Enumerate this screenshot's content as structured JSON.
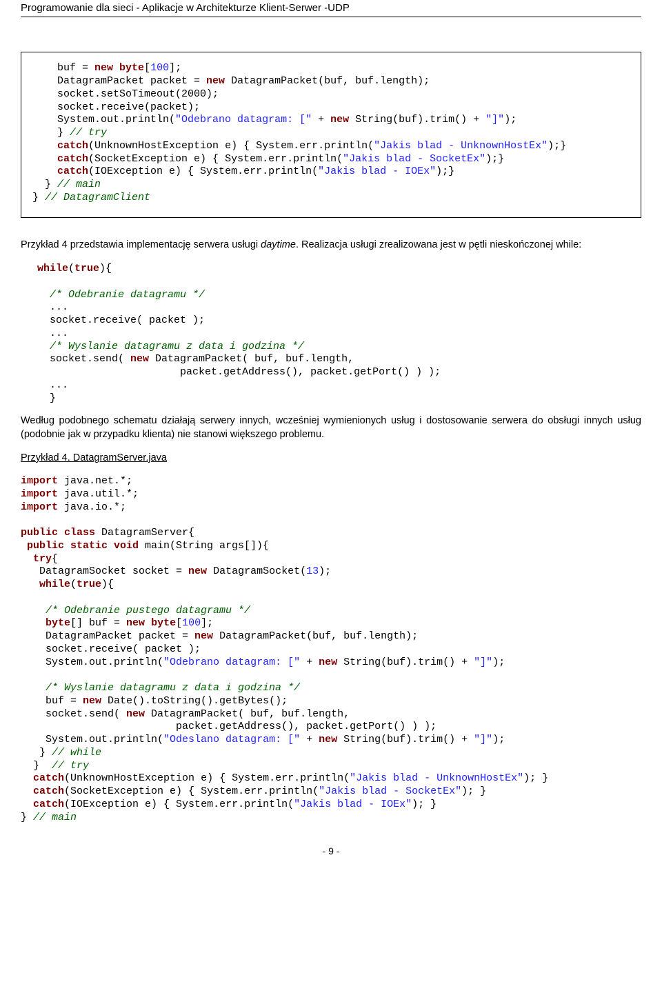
{
  "header": {
    "title": "Programowanie dla sieci - Aplikacje w Architekturze Klient-Serwer -UDP"
  },
  "code1": {
    "l1a": "    buf = ",
    "l1b": "new",
    "l1c": " ",
    "l1d": "byte",
    "l1e": "[",
    "l1f": "100",
    "l1g": "];",
    "l2a": "    DatagramPacket packet = ",
    "l2b": "new",
    "l2c": " DatagramPacket(buf, buf.length);",
    "l3": "    socket.setSoTimeout(2000);",
    "l4": "    socket.receive(packet);",
    "l5a": "    System.out.println(",
    "l5b": "\"Odebrano datagram: [\"",
    "l5c": " + ",
    "l5d": "new",
    "l5e": " String(buf).trim() + ",
    "l5f": "\"]\"",
    "l5g": ");",
    "l6a": "    } ",
    "l6b": "// try",
    "l7a": "    ",
    "l7b": "catch",
    "l7c": "(UnknownHostException e) { System.err.println(",
    "l7d": "\"Jakis blad - UnknownHostEx\"",
    "l7e": ");}",
    "l8a": "    ",
    "l8b": "catch",
    "l8c": "(SocketException e) { System.err.println(",
    "l8d": "\"Jakis blad - SocketEx\"",
    "l8e": ");}",
    "l9a": "    ",
    "l9b": "catch",
    "l9c": "(IOException e) { System.err.println(",
    "l9d": "\"Jakis blad - IOEx\"",
    "l9e": ");}",
    "l10a": "  } ",
    "l10b": "// main",
    "l11a": "} ",
    "l11b": "// DatagramClient"
  },
  "para1": {
    "t1": "Przykład 4 przedstawia implementację serwera usługi ",
    "it1": "daytime",
    "t2": ". Realizacja usługi zrealizowana jest w pętli nieskończonej while:"
  },
  "code2": {
    "l1a": "while",
    "l1b": "(",
    "l1c": "true",
    "l1d": "){",
    "blank1": "",
    "l2": "  /* Odebranie datagramu */",
    "l3": "  ...",
    "l4": "  socket.receive( packet );",
    "l5": "  ...",
    "l6": "  /* Wyslanie datagramu z data i godzina */",
    "l7a": "  socket.send( ",
    "l7b": "new",
    "l7c": " DatagramPacket( buf, buf.length,",
    "l8": "                       packet.getAddress(), packet.getPort() ) );",
    "l9": "  ...",
    "l10": "  }"
  },
  "para2": "Według podobnego schematu działają serwery innych, wcześniej wymienionych usług i dostosowanie serwera do obsługi innych usług (podobnie jak w przypadku klienta) nie stanowi większego problemu.",
  "heading4": "Przykład 4. DatagramServer.java",
  "code3": {
    "l1a": "import",
    "l1b": " java.net.*;",
    "l2a": "import",
    "l2b": " java.util.*;",
    "l3a": "import",
    "l3b": " java.io.*;",
    "blank1": "",
    "l4a": "public class",
    "l4b": " DatagramServer{",
    "l5a": " public static void",
    "l5b": " main(String args[]){",
    "l6a": "  try",
    "l6b": "{",
    "l7a": "   DatagramSocket socket = ",
    "l7b": "new",
    "l7c": " DatagramSocket(",
    "l7d": "13",
    "l7e": ");",
    "l8a": "   while",
    "l8b": "(",
    "l8c": "true",
    "l8d": "){",
    "blank2": "",
    "l9": "    /* Odebranie pustego datagramu */",
    "l10a": "    ",
    "l10b": "byte",
    "l10c": "[] buf = ",
    "l10d": "new",
    "l10e": " ",
    "l10f": "byte",
    "l10g": "[",
    "l10h": "100",
    "l10i": "];",
    "l11a": "    DatagramPacket packet = ",
    "l11b": "new",
    "l11c": " DatagramPacket(buf, buf.length);",
    "l12": "    socket.receive( packet );",
    "l13a": "    System.out.println(",
    "l13b": "\"Odebrano datagram: [\"",
    "l13c": " + ",
    "l13d": "new",
    "l13e": " String(buf).trim() + ",
    "l13f": "\"]\"",
    "l13g": ");",
    "blank3": "",
    "l14": "    /* Wyslanie datagramu z data i godzina */",
    "l15a": "    buf = ",
    "l15b": "new",
    "l15c": " Date().toString().getBytes();",
    "l16a": "    socket.send( ",
    "l16b": "new",
    "l16c": " DatagramPacket( buf, buf.length,",
    "l17": "                         packet.getAddress(), packet.getPort() ) );",
    "l18a": "    System.out.println(",
    "l18b": "\"Odeslano datagram: [\"",
    "l18c": " + ",
    "l18d": "new",
    "l18e": " String(buf).trim() + ",
    "l18f": "\"]\"",
    "l18g": ");",
    "l19a": "   } ",
    "l19b": "// while",
    "l20a": "  }  ",
    "l20b": "// try",
    "l21a": "  ",
    "l21b": "catch",
    "l21c": "(UnknownHostException e) { System.err.println(",
    "l21d": "\"Jakis blad - UnknownHostEx\"",
    "l21e": "); }",
    "l22a": "  ",
    "l22b": "catch",
    "l22c": "(SocketException e) { System.err.println(",
    "l22d": "\"Jakis blad - SocketEx\"",
    "l22e": "); }",
    "l23a": "  ",
    "l23b": "catch",
    "l23c": "(IOException e) { System.err.println(",
    "l23d": "\"Jakis blad - IOEx\"",
    "l23e": "); }",
    "l24a": "} ",
    "l24b": "// main"
  },
  "footer": "- 9 -"
}
